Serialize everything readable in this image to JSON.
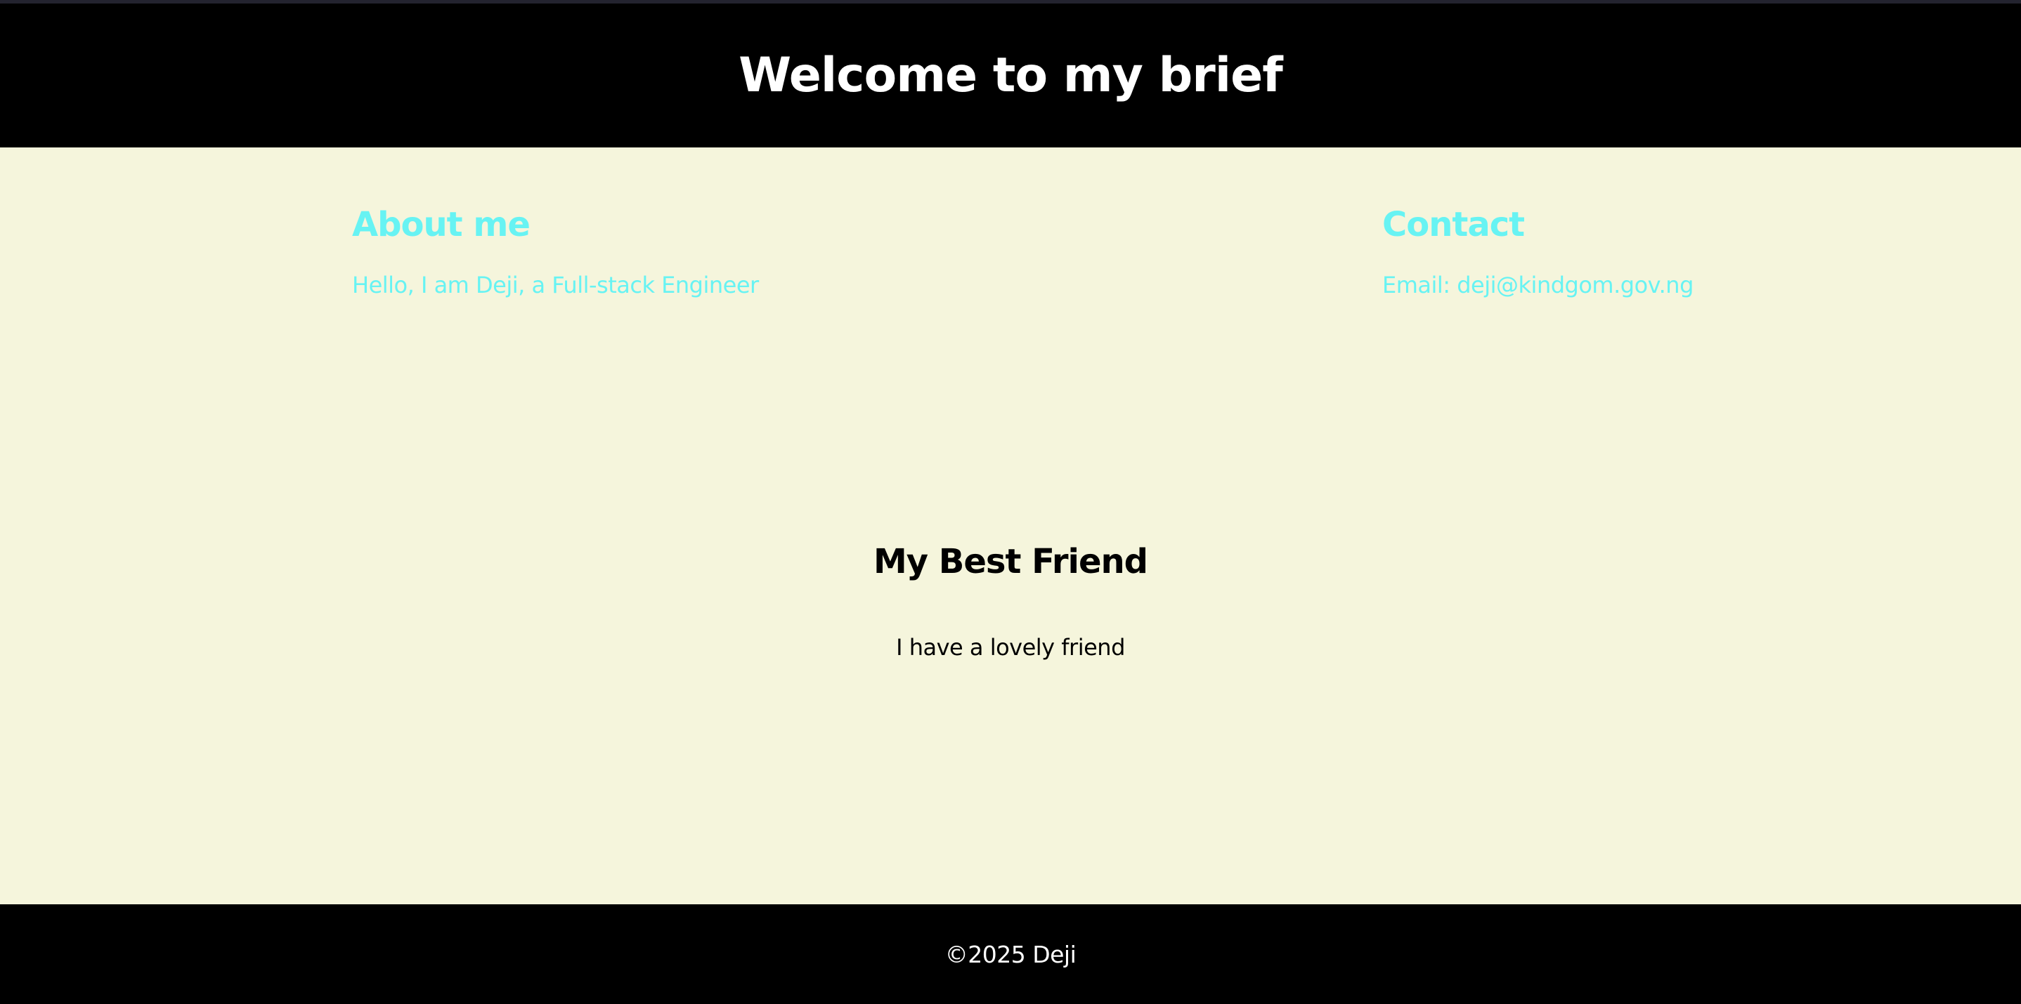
{
  "header": {
    "title": "Welcome to my brief"
  },
  "about": {
    "heading": "About me",
    "text": "Hello, I am Deji, a Full-stack Engineer"
  },
  "contact": {
    "heading": "Contact",
    "text": "Email: deji@kindgom.gov.ng"
  },
  "best_friend": {
    "heading": "My Best Friend",
    "text": "I have a lovely friend"
  },
  "footer": {
    "text": "©2025 Deji"
  },
  "colors": {
    "page_background": "#f5f5dc",
    "header_background": "#000000",
    "footer_background": "#000000",
    "header_text": "#ffffff",
    "accent_text": "#67f3f3",
    "body_text": "#000000",
    "footer_text": "#ffffff"
  }
}
